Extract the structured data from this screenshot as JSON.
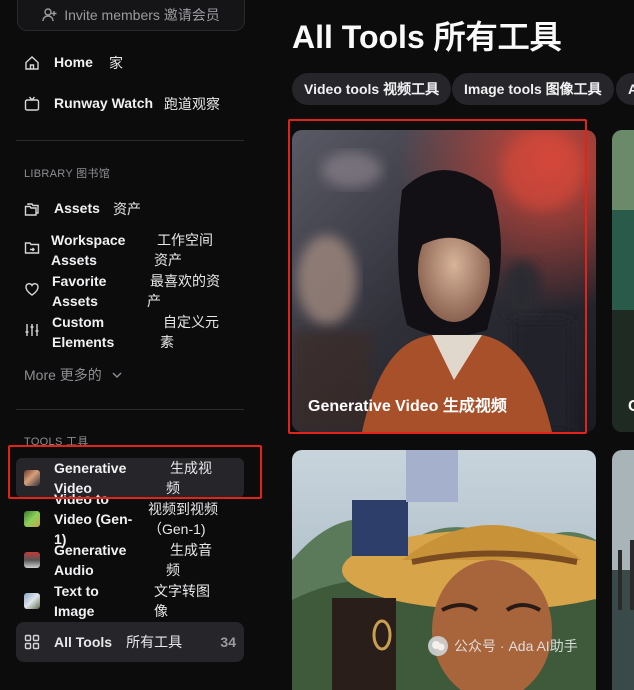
{
  "invite": {
    "label": "Invite members 邀请会员"
  },
  "nav": {
    "home": {
      "en": "Home",
      "cn": "家"
    },
    "runway_watch": {
      "en": "Runway Watch",
      "cn": "跑道观察"
    }
  },
  "library": {
    "label": "LIBRARY 图书馆",
    "items": [
      {
        "en": "Assets",
        "cn": "资产"
      },
      {
        "en1": "Workspace",
        "en2": "Assets",
        "cn1": "工作空间",
        "cn2": "资产"
      },
      {
        "en1": "Favorite",
        "en2": "Assets",
        "cn1": "最喜欢的资",
        "cn2": "产"
      },
      {
        "en1": "Custom",
        "en2": "Elements",
        "cn1": "自定义元",
        "cn2": "素"
      }
    ],
    "more": "More 更多的"
  },
  "tools": {
    "label": "TOOLS 工具",
    "items": [
      {
        "en1": "Generative",
        "en2": "Video",
        "cn1": "生成视",
        "cn2": "频"
      },
      {
        "en1": "Video to",
        "en2": "Video (Gen-",
        "en3": "1)",
        "cn1": "视频到视频",
        "cn2": "（Gen-1)"
      },
      {
        "en1": "Generative",
        "en2": "Audio",
        "cn1": "生成音",
        "cn2": "频"
      },
      {
        "en1": "Text to",
        "en2": "Image",
        "cn1": "文字转图",
        "cn2": "像"
      }
    ],
    "all_tools": {
      "en": "All Tools",
      "cn": "所有工具",
      "count": "34"
    }
  },
  "main": {
    "title": "All Tools 所有工具",
    "filters": [
      "Video tools 视频工具",
      "Image tools 图像工具",
      "A"
    ],
    "cards": [
      {
        "label": "Generative Video 生成视频"
      },
      {
        "label": "G"
      }
    ]
  },
  "watermark": {
    "text": "公众号 · Ada AI助手"
  }
}
